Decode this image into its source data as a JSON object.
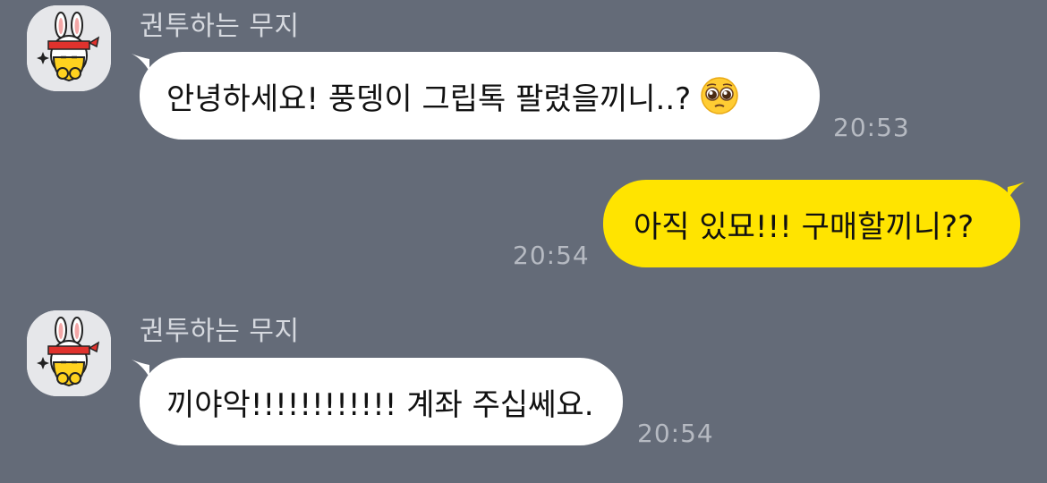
{
  "messages": [
    {
      "sender": "권투하는 무지",
      "avatar_icon": "muzi-boxing-avatar-icon",
      "text": "안녕하세요! 풍뎅이 그립톡 팔렸을끼니..?",
      "emoji_icon": "pleading-face-icon",
      "time": "20:53",
      "direction": "incoming"
    },
    {
      "text": "아직 있묘!!! 구매할끼니??",
      "time": "20:54",
      "direction": "outgoing"
    },
    {
      "sender": "권투하는 무지",
      "avatar_icon": "muzi-boxing-avatar-icon",
      "text": "끼야악!!!!!!!!!!!! 계좌 주십쎄요.",
      "time": "20:54",
      "direction": "incoming"
    }
  ],
  "colors": {
    "background": "#646B78",
    "incoming_bubble": "#FFFFFF",
    "outgoing_bubble": "#FFE400",
    "name_text": "#D6D9DF",
    "time_text": "#B6BAC2"
  }
}
